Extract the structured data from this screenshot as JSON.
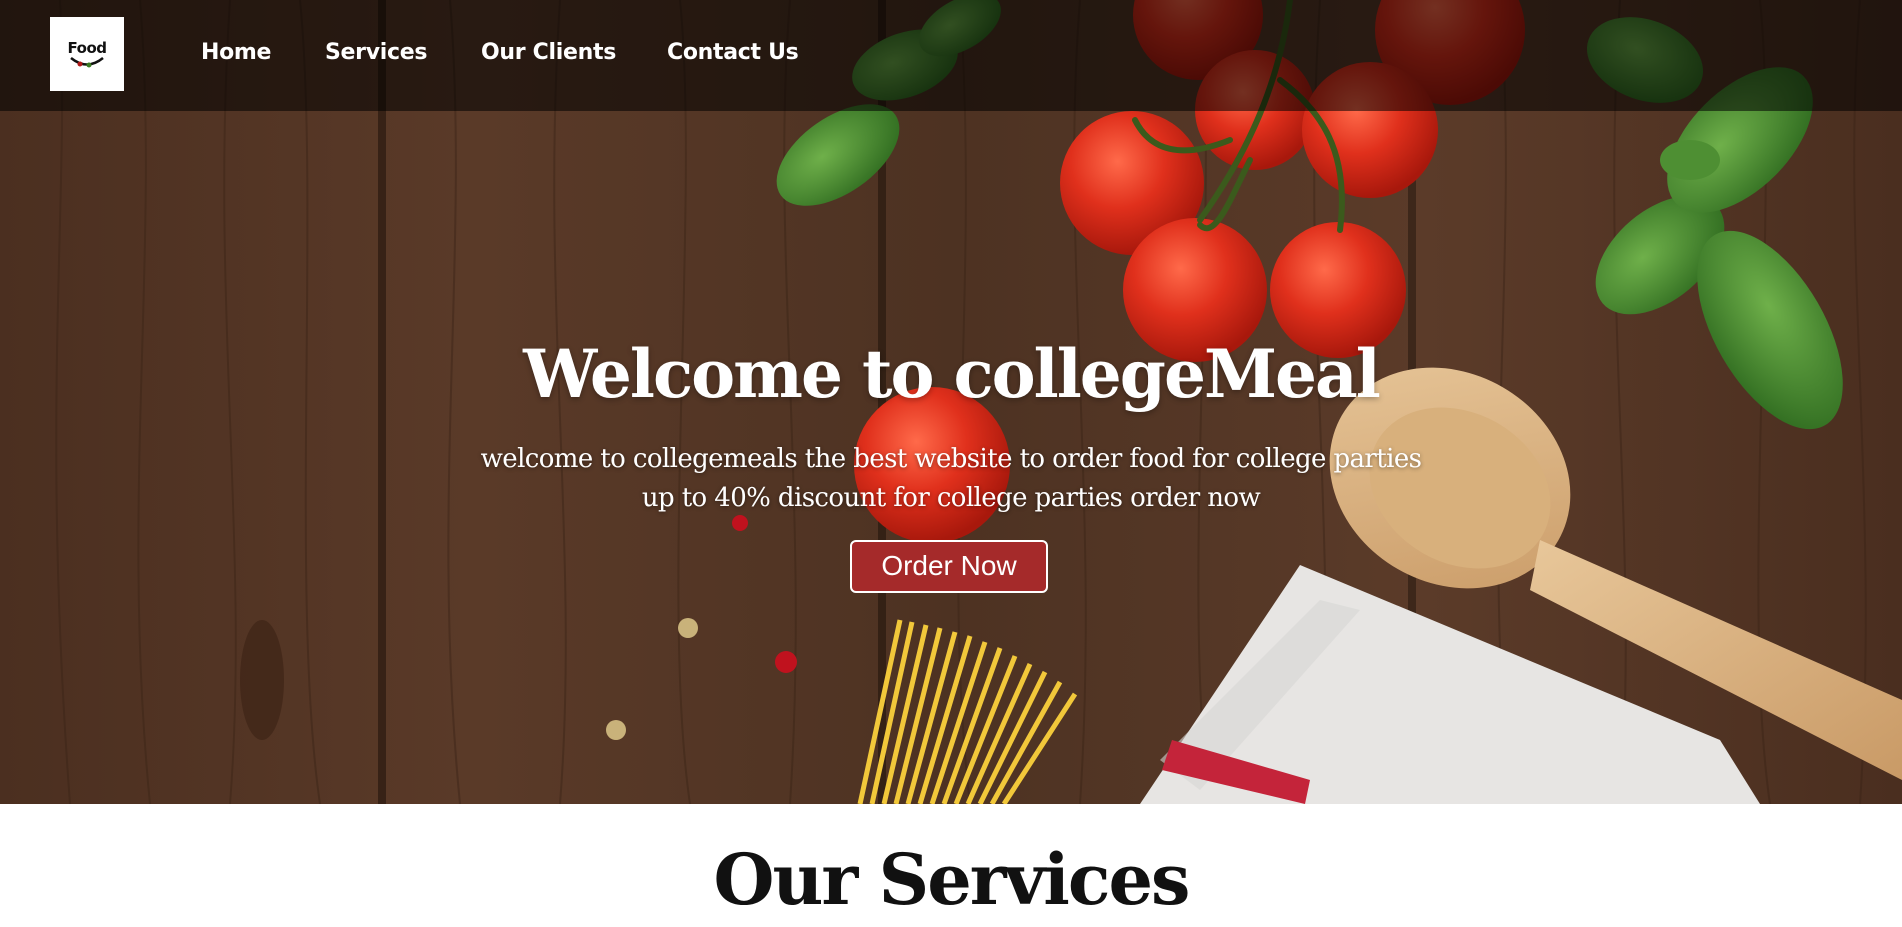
{
  "logo": {
    "text": "Food"
  },
  "nav": {
    "items": [
      {
        "label": "Home"
      },
      {
        "label": "Services"
      },
      {
        "label": "Our Clients"
      },
      {
        "label": "Contact Us"
      }
    ]
  },
  "hero": {
    "title": "Welcome to collegeMeal",
    "subtitle_line1": "welcome to collegemeals the best website to order food for college parties",
    "subtitle_line2": "up to 40% discount for college parties order now",
    "cta_label": "Order Now"
  },
  "services": {
    "heading": "Our Services"
  },
  "colors": {
    "accent": "#a52a2a",
    "navbar_overlay": "rgba(0,0,0,0.55)",
    "wood": "#4a3021"
  }
}
